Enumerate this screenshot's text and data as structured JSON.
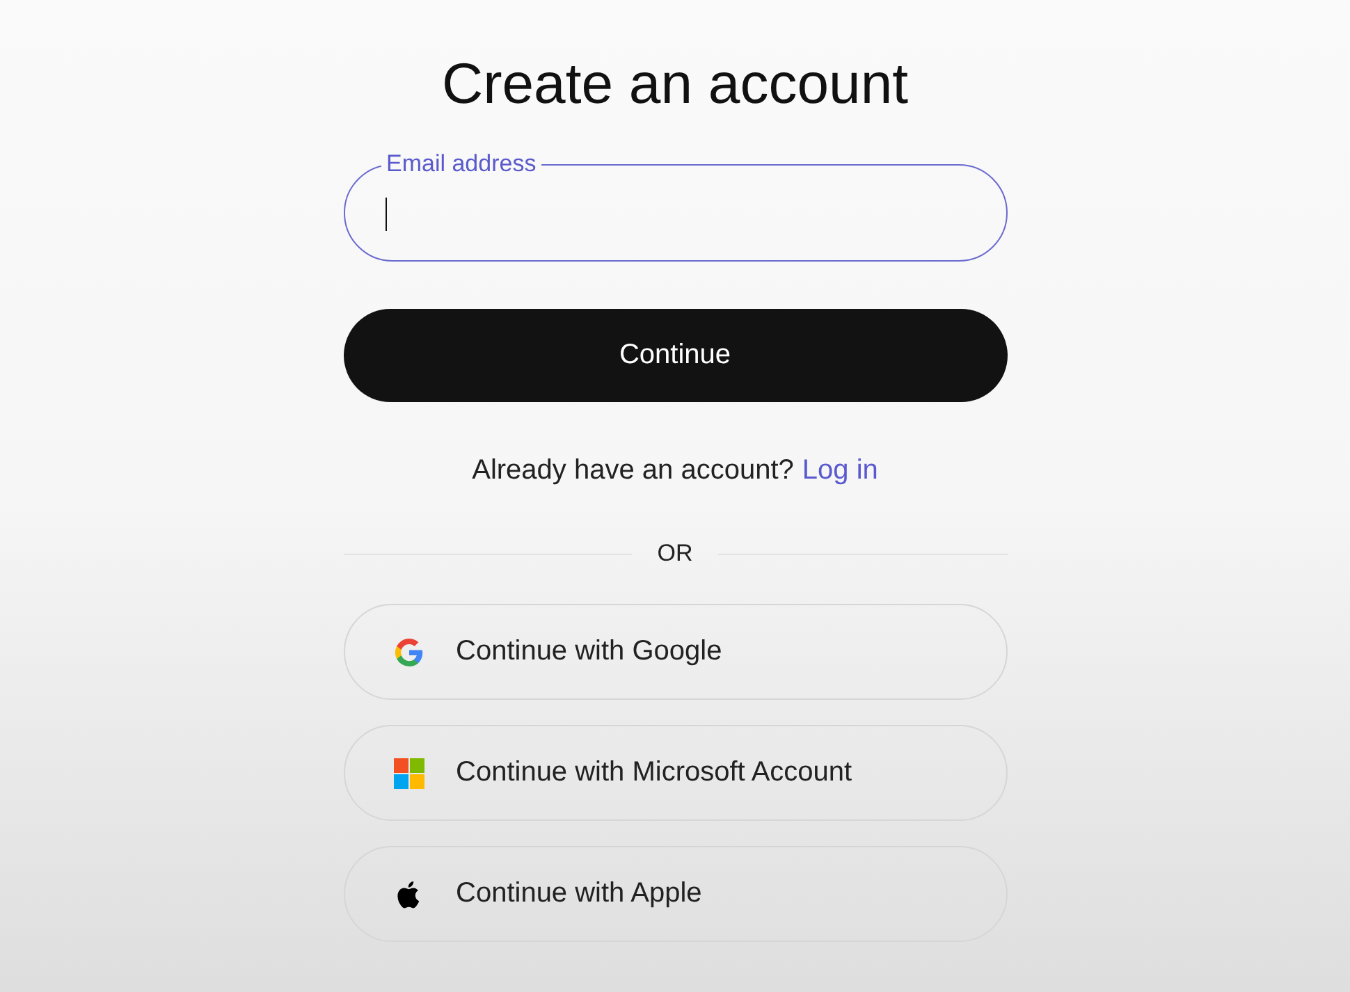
{
  "title": "Create an account",
  "email_field": {
    "label": "Email address",
    "focused": true
  },
  "continue_button": "Continue",
  "login_prompt": {
    "text": "Already have an account?",
    "link": "Log in"
  },
  "divider_text": "OR",
  "social_buttons": [
    {
      "kind": "google",
      "label": "Continue with Google"
    },
    {
      "kind": "microsoft",
      "label": "Continue with Microsoft Account"
    },
    {
      "kind": "apple",
      "label": "Continue with Apple"
    }
  ]
}
